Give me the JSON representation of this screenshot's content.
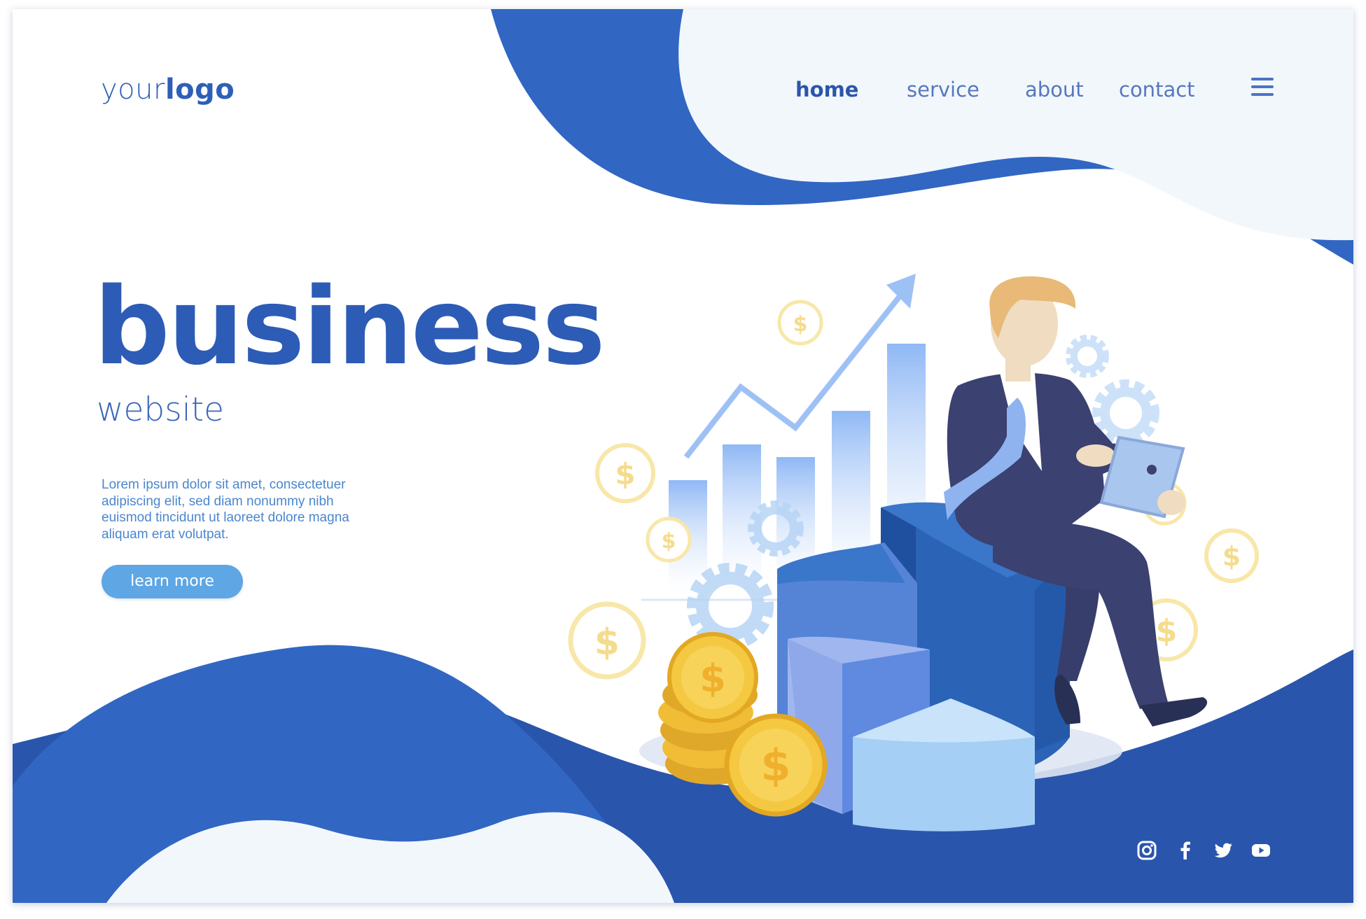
{
  "logo": {
    "light": "your",
    "bold": "logo"
  },
  "nav": {
    "items": [
      {
        "label": "home",
        "active": true
      },
      {
        "label": "service",
        "active": false
      },
      {
        "label": "about",
        "active": false
      },
      {
        "label": "contact",
        "active": false
      }
    ],
    "menu_icon": "hamburger-menu-icon"
  },
  "hero": {
    "title": "business",
    "subtitle": "website",
    "body_lines": [
      "Lorem ipsum dolor sit amet, consectetuer",
      "adipiscing elit, sed diam nonummy nibh",
      "euismod tincidunt ut laoreet dolore magna",
      "aliquam erat volutpat."
    ],
    "cta_label": "learn more"
  },
  "social": {
    "icons": [
      "instagram-icon",
      "facebook-icon",
      "twitter-icon",
      "youtube-icon"
    ]
  },
  "illustration": {
    "coin_symbol": "$"
  },
  "colors": {
    "primary_blue": "#2d5cb6",
    "dark_blue": "#2a52a6",
    "pale_blue": "#f2f7fc",
    "cta_blue": "#5ea6e4",
    "coin_gold": "#f5c842",
    "suit_navy": "#3b4170"
  }
}
